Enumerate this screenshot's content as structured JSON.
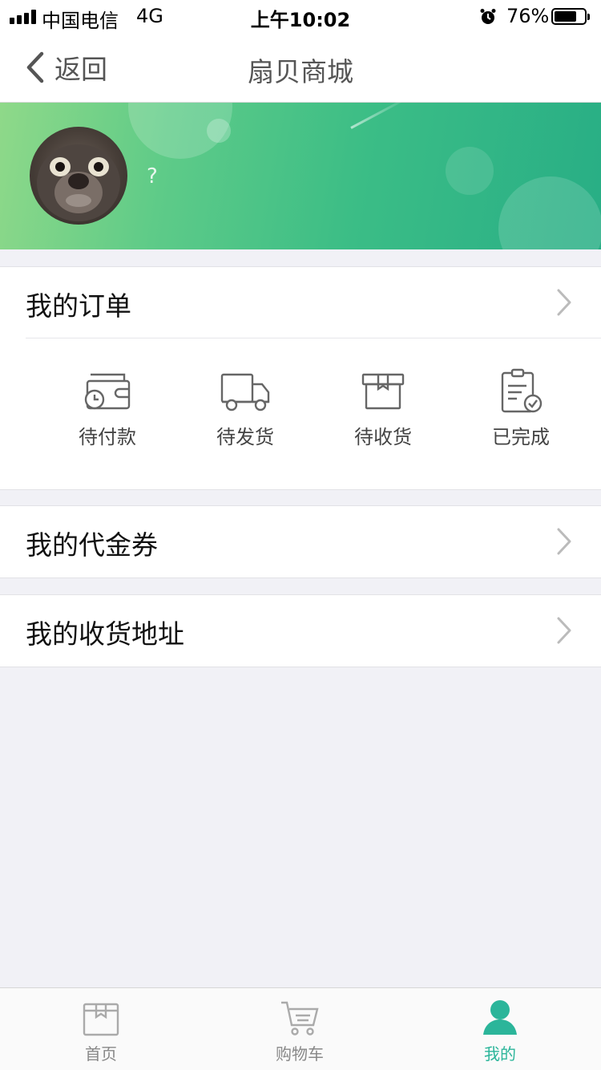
{
  "status_bar": {
    "carrier": "中国电信",
    "network": "4G",
    "time": "上午10:02",
    "battery_percent": "76%",
    "battery_level": 0.76
  },
  "nav": {
    "back_label": "返回",
    "title": "扇贝商城"
  },
  "profile": {
    "username": "?",
    "banner_colors": [
      "#8fd989",
      "#28ae85"
    ]
  },
  "orders": {
    "title": "我的订单",
    "statuses": [
      {
        "label": "待付款",
        "icon": "wallet-clock-icon"
      },
      {
        "label": "待发货",
        "icon": "truck-icon"
      },
      {
        "label": "待收货",
        "icon": "package-icon"
      },
      {
        "label": "已完成",
        "icon": "clipboard-check-icon"
      }
    ]
  },
  "menu": {
    "vouchers": "我的代金券",
    "addresses": "我的收货地址"
  },
  "tabs": [
    {
      "label": "首页",
      "icon": "box-icon",
      "active": false
    },
    {
      "label": "购物车",
      "icon": "cart-icon",
      "active": false
    },
    {
      "label": "我的",
      "icon": "user-icon",
      "active": true
    }
  ],
  "accent_color": "#2bb59a"
}
